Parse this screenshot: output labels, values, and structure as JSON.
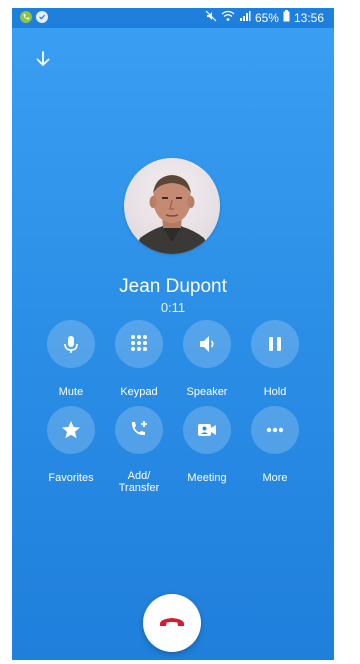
{
  "status_bar": {
    "battery_text": "65%",
    "time": "13:56",
    "icons": [
      "phone-notification-icon",
      "check-notification-icon",
      "mute-icon",
      "wifi-icon",
      "signal-icon",
      "battery-icon"
    ]
  },
  "call": {
    "caller_name": "Jean Dupont",
    "timer": "0:11"
  },
  "controls": {
    "mute": "Mute",
    "keypad": "Keypad",
    "speaker": "Speaker",
    "hold": "Hold",
    "favorites": "Favorites",
    "add_transfer_line1": "Add/",
    "add_transfer_line2": "Transfer",
    "meeting": "Meeting",
    "more": "More"
  },
  "colors": {
    "background": "#2b8ee6",
    "end_call": "#d21e2b"
  }
}
